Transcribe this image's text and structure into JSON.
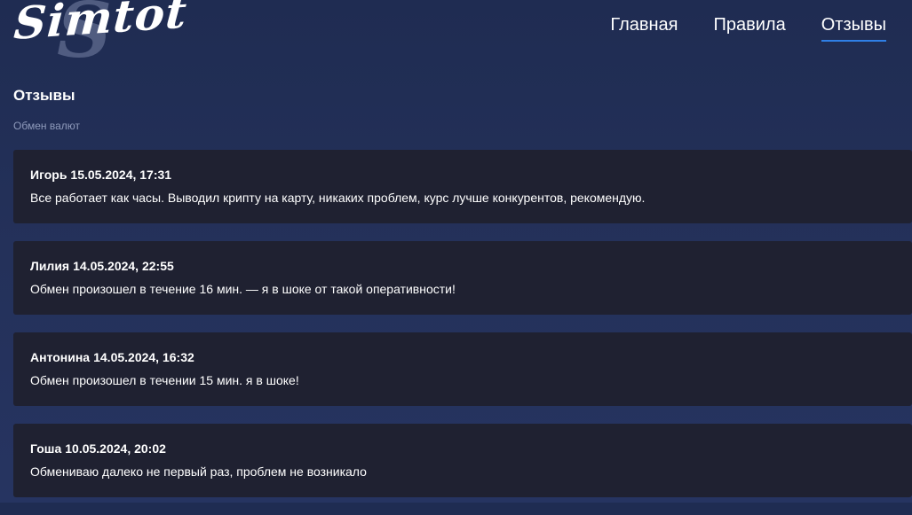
{
  "brand": {
    "name": "Simtot",
    "watermark_letter": "S"
  },
  "nav": {
    "items": [
      {
        "label": "Главная",
        "active": false
      },
      {
        "label": "Правила",
        "active": false
      },
      {
        "label": "Отзывы",
        "active": true
      }
    ],
    "active_underline_color": "#2f7fe6"
  },
  "page": {
    "title": "Отзывы",
    "subtitle": "Обмен валют"
  },
  "reviews": [
    {
      "author": "Игорь",
      "datetime": "15.05.2024, 17:31",
      "text": "Все работает как часы. Выводил крипту на карту, никаких проблем, курс лучше конкурентов, рекомендую."
    },
    {
      "author": "Лилия",
      "datetime": "14.05.2024, 22:55",
      "text": "Обмен произошел в течение 16 мин. — я в шоке от такой оперативности!"
    },
    {
      "author": "Антонина",
      "datetime": "14.05.2024, 16:32",
      "text": "Обмен произошел в течении 15 мин. я в шоке!"
    },
    {
      "author": "Гоша",
      "datetime": "10.05.2024, 20:02",
      "text": "Обмениваю далеко не первый раз, проблем не возникало"
    }
  ],
  "colors": {
    "background": "#24315a",
    "card": "#1f2131",
    "subtitle": "#8f9abb"
  }
}
